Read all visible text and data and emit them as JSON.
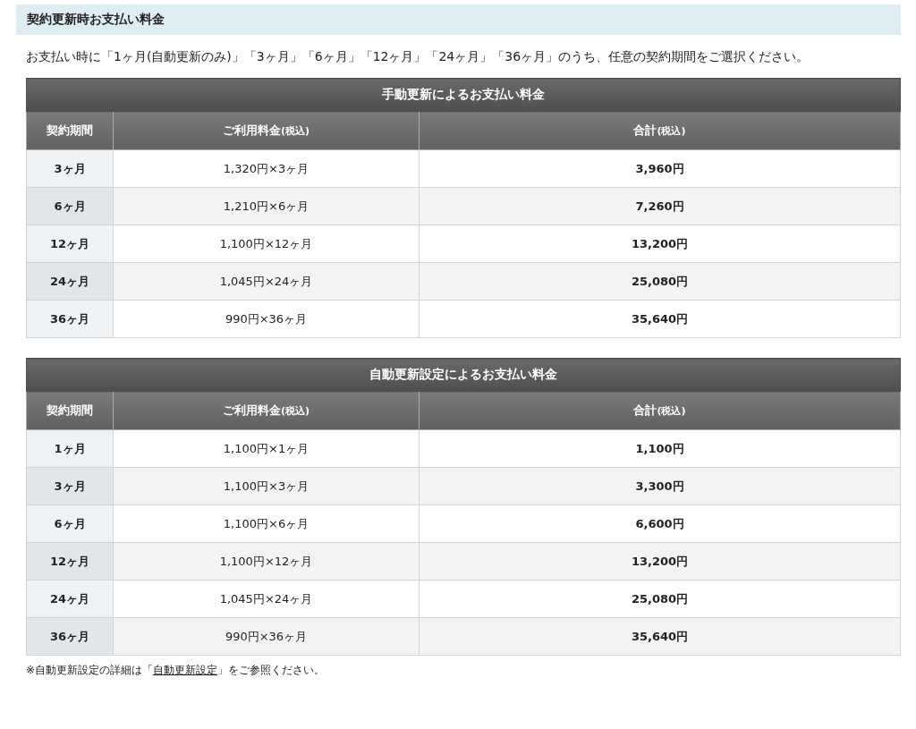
{
  "section_heading": "契約更新時お支払い料金",
  "intro": "お支払い時に「1ヶ月(自動更新のみ)」「3ヶ月」「6ヶ月」「12ヶ月」「24ヶ月」「36ヶ月」のうち、任意の契約期間をご選択ください。",
  "tables": [
    {
      "title": "手動更新によるお支払い料金",
      "columns": [
        {
          "text": "契約期間"
        },
        {
          "text": "ご利用料金",
          "note": "(税込)"
        },
        {
          "text": "合計",
          "note": "(税込)"
        }
      ],
      "rows": [
        {
          "period": "3ヶ月",
          "unit_price": "1,320円×3ヶ月",
          "total": "3,960円"
        },
        {
          "period": "6ヶ月",
          "unit_price": "1,210円×6ヶ月",
          "total": "7,260円"
        },
        {
          "period": "12ヶ月",
          "unit_price": "1,100円×12ヶ月",
          "total": "13,200円"
        },
        {
          "period": "24ヶ月",
          "unit_price": "1,045円×24ヶ月",
          "total": "25,080円"
        },
        {
          "period": "36ヶ月",
          "unit_price": "990円×36ヶ月",
          "total": "35,640円"
        }
      ]
    },
    {
      "title": "自動更新設定によるお支払い料金",
      "columns": [
        {
          "text": "契約期間"
        },
        {
          "text": "ご利用料金",
          "note": "(税込)"
        },
        {
          "text": "合計",
          "note": "(税込)"
        }
      ],
      "rows": [
        {
          "period": "1ヶ月",
          "unit_price": "1,100円×1ヶ月",
          "total": "1,100円"
        },
        {
          "period": "3ヶ月",
          "unit_price": "1,100円×3ヶ月",
          "total": "3,300円"
        },
        {
          "period": "6ヶ月",
          "unit_price": "1,100円×6ヶ月",
          "total": "6,600円"
        },
        {
          "period": "12ヶ月",
          "unit_price": "1,100円×12ヶ月",
          "total": "13,200円"
        },
        {
          "period": "24ヶ月",
          "unit_price": "1,045円×24ヶ月",
          "total": "25,080円"
        },
        {
          "period": "36ヶ月",
          "unit_price": "990円×36ヶ月",
          "total": "35,640円"
        }
      ]
    }
  ],
  "footnote": {
    "before": "※自動更新設定の詳細は「",
    "link": "自動更新設定",
    "after": "」をご参照ください。"
  }
}
